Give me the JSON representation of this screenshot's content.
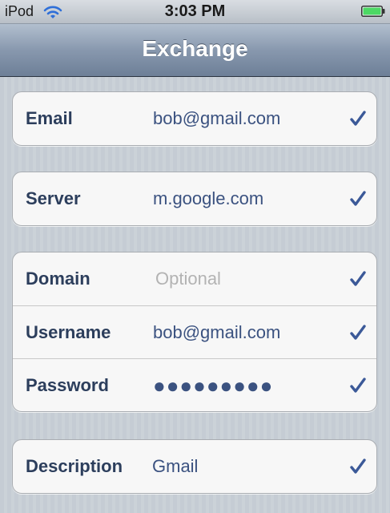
{
  "status_bar": {
    "carrier": "iPod",
    "time": "3:03 PM",
    "wifi_icon": "wifi-icon",
    "battery_icon": "battery-icon",
    "battery_color": "#4cd964"
  },
  "nav": {
    "title": "Exchange"
  },
  "groups": [
    {
      "rows": [
        {
          "label": "Email",
          "value": "bob@gmail.com",
          "checked": true
        }
      ]
    },
    {
      "rows": [
        {
          "label": "Server",
          "value": "m.google.com",
          "checked": true
        }
      ]
    },
    {
      "rows": [
        {
          "label": "Domain",
          "placeholder": "Optional",
          "value": "",
          "checked": true
        },
        {
          "label": "Username",
          "value": "bob@gmail.com",
          "checked": true
        },
        {
          "label": "Password",
          "value": "●●●●●●●●●",
          "checked": true
        }
      ]
    },
    {
      "rows": [
        {
          "label": "Description",
          "value": "Gmail",
          "checked": true
        }
      ]
    }
  ],
  "colors": {
    "label": "#2c3e5c",
    "value": "#3b5280",
    "placeholder": "#b3b3b3",
    "check": "#3b5998"
  }
}
